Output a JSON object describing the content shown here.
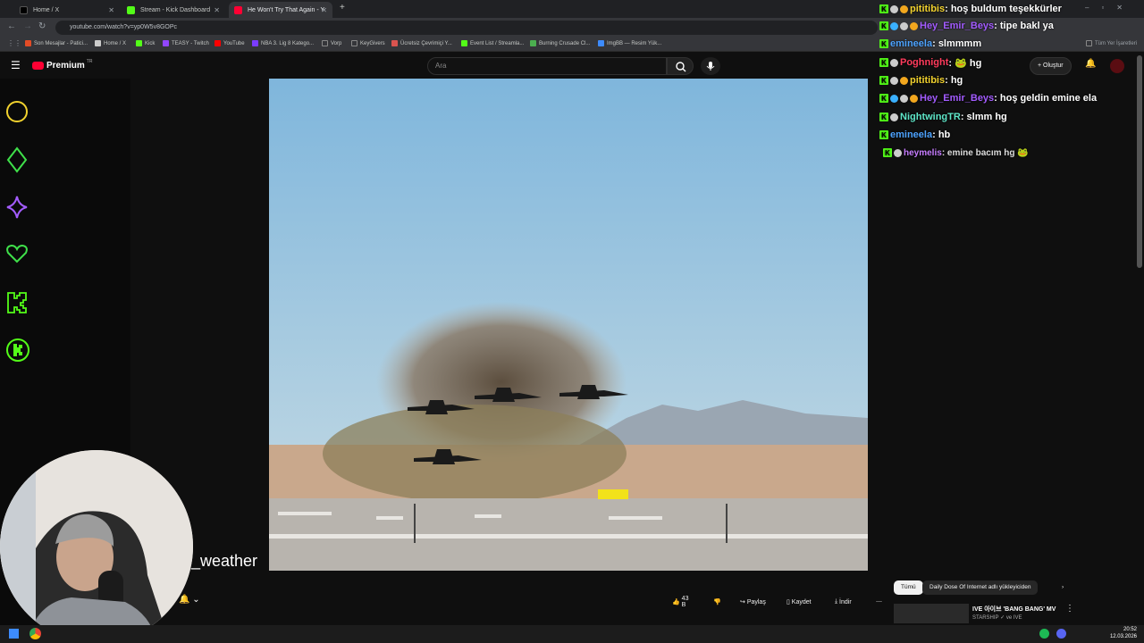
{
  "browser": {
    "tabs": [
      {
        "label": "Home / X",
        "favicon_color": "#000000"
      },
      {
        "label": "Stream - Kick Dashboard",
        "favicon_color": "#53fc18"
      },
      {
        "label": "He Won't Try That Again - Y",
        "favicon_color": "#ff0033"
      }
    ],
    "new_tab_icon": "plus-icon",
    "url": "youtube.com/watch?v=yp0W5v8GOPc",
    "bookmarks": [
      {
        "label": "Son Mesajlar - Patici...",
        "color": "#e34c26"
      },
      {
        "label": "Home / X",
        "color": "#cccccc"
      },
      {
        "label": "Kick",
        "color": "#53fc18"
      },
      {
        "label": "TEASY - Twitch",
        "color": "#9146ff"
      },
      {
        "label": "YouTube",
        "color": "#ff0000"
      },
      {
        "label": "NBA 3. Lig 8 Katego...",
        "color": "#7a3cff"
      },
      {
        "label": "Vorp",
        "color": "#888888"
      },
      {
        "label": "KeyGivers",
        "color": "#888888"
      },
      {
        "label": "Ücretsiz Çevrimiçi Y...",
        "color": "#d9534f"
      },
      {
        "label": "Event List / Streamla...",
        "color": "#53fc18"
      },
      {
        "label": "Burning Crusade Cl...",
        "color": "#4caf50"
      },
      {
        "label": "ImgBB — Resim Yük...",
        "color": "#3d8bfd"
      }
    ],
    "all_bookmarks": "Tüm Yer İşaretleri"
  },
  "youtube": {
    "logo_text": "Premium",
    "logo_region": "TR",
    "search_placeholder": "Ara",
    "create_label": "Oluştur",
    "likes": "43 B",
    "share_label": "Paylaş",
    "save_label": "Kaydet",
    "download_label": "İndir",
    "chips": [
      "Tümü",
      "Daily Dose Of Internet adlı yükleyiciden"
    ],
    "rec_title": "IVE 아이브 'BANG BANG' MV",
    "rec_channel": "STARSHIP ✓ ve IVE"
  },
  "overlay": {
    "weather_text": "_weather",
    "shapes": [
      {
        "name": "circle-shape",
        "color": "#f2d22e"
      },
      {
        "name": "diamond-shape",
        "color": "#3fe04a"
      },
      {
        "name": "star-shape",
        "color": "#a35cff"
      },
      {
        "name": "heart-shape",
        "color": "#3fe04a"
      },
      {
        "name": "kick-k-icon",
        "color": "#53fc18"
      },
      {
        "name": "kick-badge-icon",
        "color": "#53fc18"
      }
    ]
  },
  "chat": [
    {
      "user": "pititibis",
      "text": ": hoş buldum teşekkürler",
      "color": "#f2d22e"
    },
    {
      "user": "Hey_Emir_Beys",
      "text": ": tipe bakl ya",
      "color": "#a35cff"
    },
    {
      "user": "emineela",
      "text": ": slmmmm",
      "color": "#4da3ff"
    },
    {
      "user": "Poghnight",
      "text": ": 🐸 hg",
      "color": "#ff3b5c"
    },
    {
      "user": "pititibis",
      "text": ": hg",
      "color": "#f2d22e"
    },
    {
      "user": "Hey_Emir_Beys",
      "text": ": hoş geldin emine ela",
      "color": "#a35cff"
    },
    {
      "user": "NightwingTR",
      "text": ": slmm hg",
      "color": "#5ee6c8"
    },
    {
      "user": "emineela",
      "text": ": hb",
      "color": "#4da3ff"
    },
    {
      "user": "heymelis",
      "text": ": emine bacım hg 🐸",
      "color": "#c77dff"
    }
  ],
  "taskbar": {
    "time": "20:52",
    "date": "12.03.2026"
  }
}
